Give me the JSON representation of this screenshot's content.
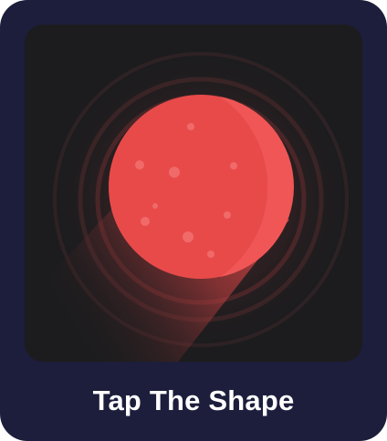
{
  "app": {
    "title": "Tap The Shape",
    "icon": "red-planet-icon"
  },
  "colors": {
    "frame": "#1c1e3c",
    "background": "#1c1c1e",
    "planet": "#e84a4a",
    "planet_highlight": "#f25555",
    "ring": "#4a2426",
    "title": "#ffffff"
  }
}
